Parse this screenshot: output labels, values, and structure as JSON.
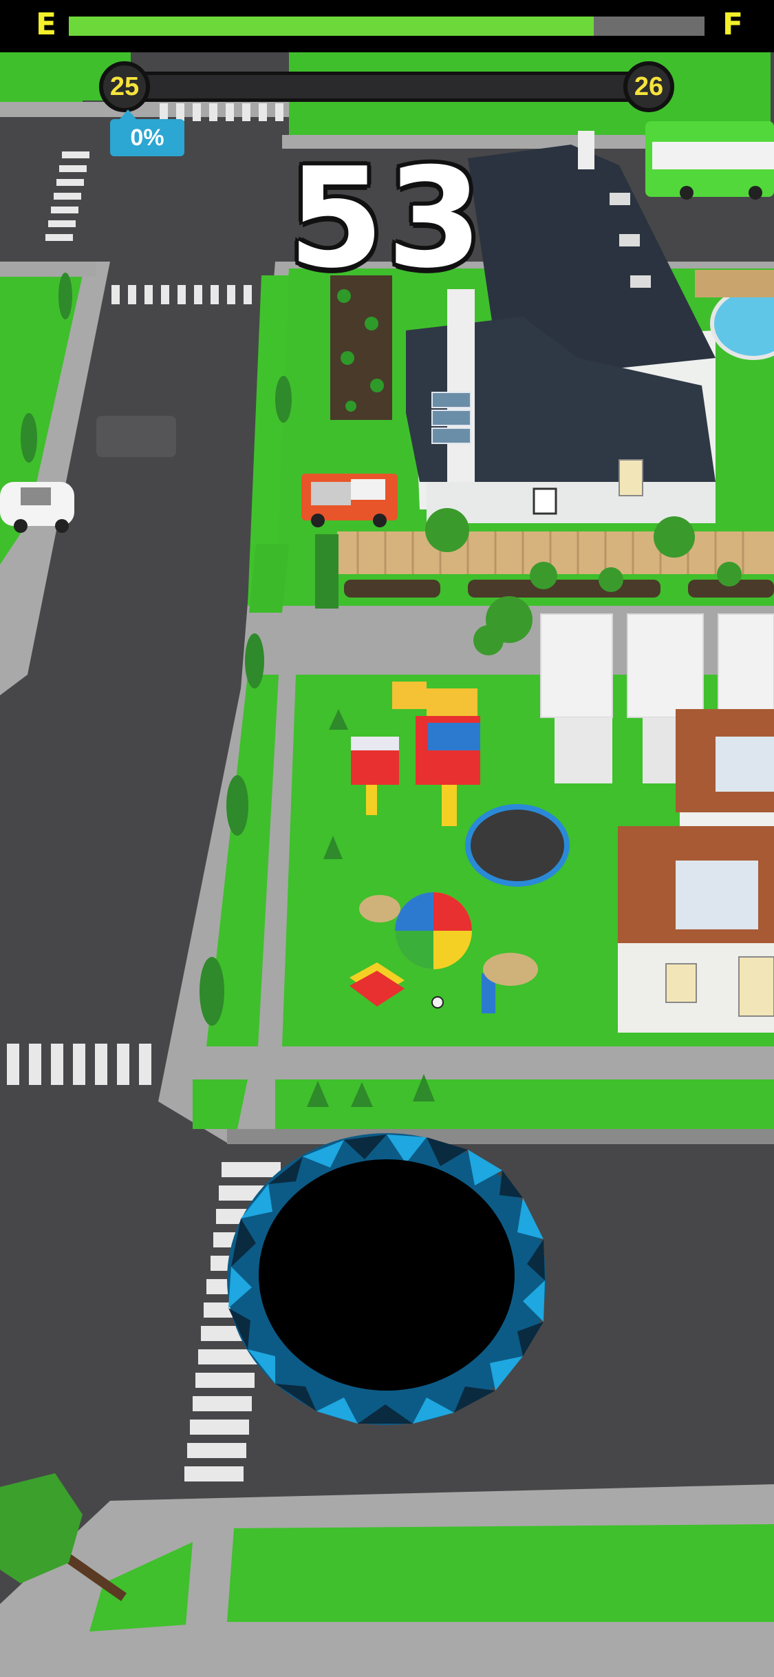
{
  "fuel": {
    "empty_label": "E",
    "full_label": "F",
    "level": 0.826
  },
  "level": {
    "current": "25",
    "next": "26",
    "progress": 0,
    "percent_label": "0%"
  },
  "timer": {
    "value": "53"
  },
  "colors": {
    "fuel_fill": "#6dd83a",
    "badge_text": "#f6e33c",
    "hole_ring": "#1e9fd8",
    "accent": "#2ca6d3"
  },
  "icons": {
    "player": "black-hole"
  }
}
